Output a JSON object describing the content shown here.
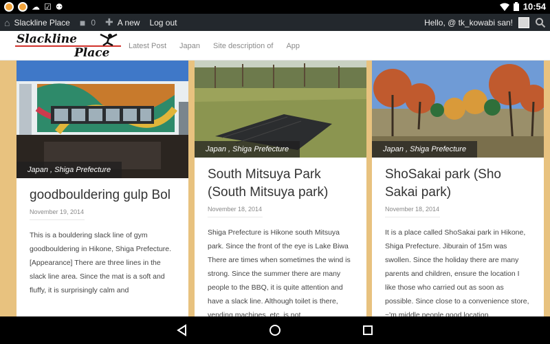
{
  "statusbar": {
    "time": "10:54"
  },
  "adminbar": {
    "site_name": "Slackline Place",
    "comments_count": "0",
    "new_label": "A new",
    "logout_label": "Log out",
    "greeting": "Hello, @ tk_kowabi san!"
  },
  "header": {
    "logo_line1": "Slackline",
    "logo_line2": "Place",
    "nav": [
      "Latest Post",
      "Japan",
      "Site description of",
      "App"
    ]
  },
  "posts": [
    {
      "tag": "Japan , Shiga Prefecture",
      "title": "goodbouldering gulp Bol",
      "date": "November 19, 2014",
      "excerpt": "This is a bouldering slack line of gym goodbouldering in Hikone, Shiga Prefecture. [Appearance] There are three lines in the slack line area. Since the mat is a soft and fluffy, it is surprisingly calm and"
    },
    {
      "tag": "Japan , Shiga Prefecture",
      "title": "South Mitsuya Park (South Mitsuya park)",
      "date": "November 18, 2014",
      "excerpt": "  Shiga Prefecture is Hikone south Mitsuya park. Since the front of the eye is Lake Biwa There are times when sometimes the wind is strong. Since the summer there are many people to the BBQ, it is quite attention and have a slack line. Although toilet is there, vending machines, etc. is not"
    },
    {
      "tag": "Japan , Shiga Prefecture",
      "title": "ShoSakai park (Sho Sakai park)",
      "date": "November 18, 2014",
      "excerpt": "It is a place called ShoSakai park in Hikone, Shiga Prefecture. Jiburain of 15m was swollen. Since the holiday there are many parents and children, ensure the location I like those who carried out as soon as possible. Since close to a convenience store, ~'m middle people good location."
    }
  ]
}
